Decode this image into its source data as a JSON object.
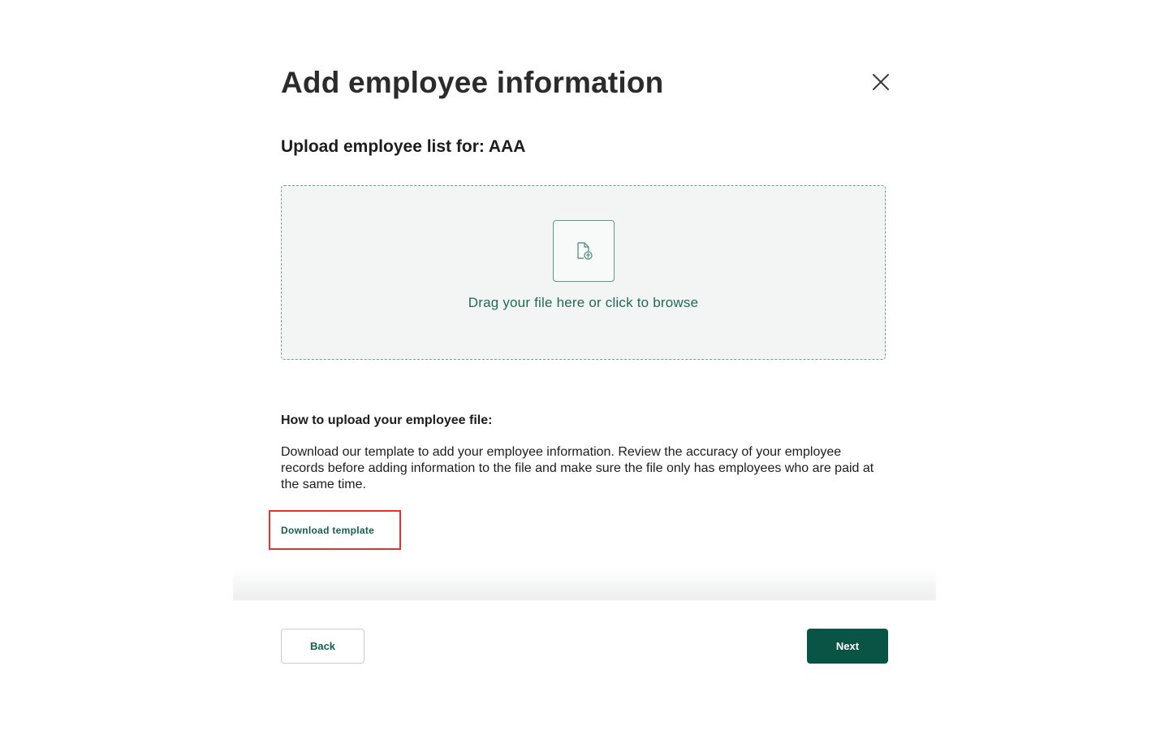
{
  "modal": {
    "title": "Add employee information",
    "close_icon": "close-icon"
  },
  "upload": {
    "section_title": "Upload employee list for: AAA",
    "dropzone_text": "Drag your file here or click to browse",
    "icon": "file-upload-icon"
  },
  "instructions": {
    "title": "How to upload your employee file:",
    "body": "Download our template to add your employee information. Review the accuracy of your employee records before adding information to the file and make sure the file only has employees who are paid at the same time.",
    "download_link": "Download template"
  },
  "footer": {
    "back_label": "Back",
    "next_label": "Next"
  },
  "colors": {
    "primary": "#0a5446",
    "link": "#14604f",
    "dropzone_border": "#6ea48f",
    "dropzone_bg": "#f2f5f4",
    "highlight": "#e0372d"
  }
}
